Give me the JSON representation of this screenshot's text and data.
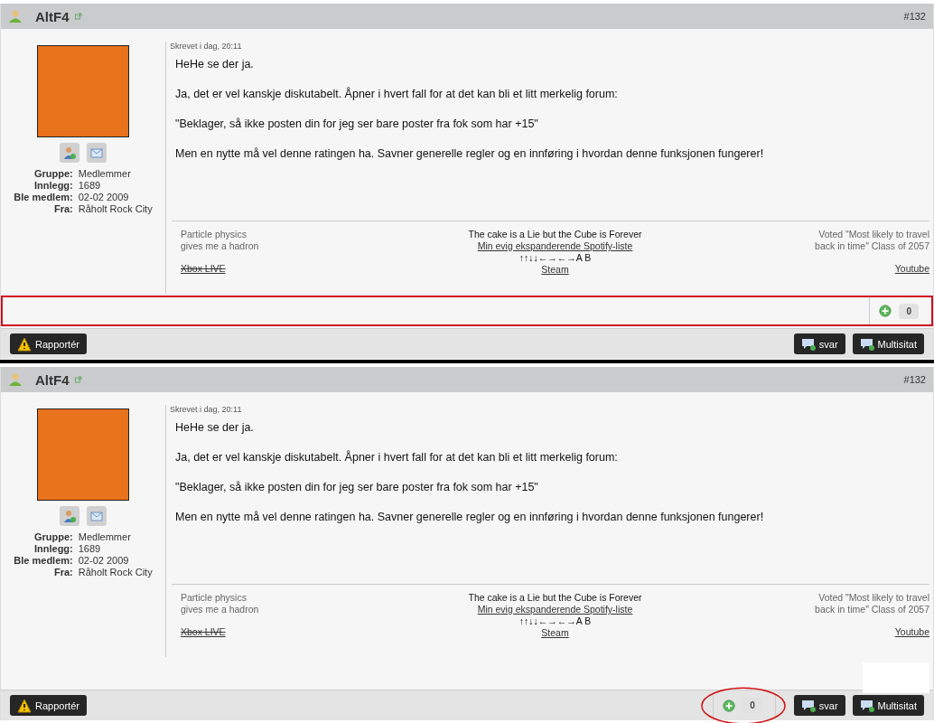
{
  "posts": [
    {
      "author": "AltF4",
      "post_number": "#132",
      "timestamp": "Skrevet i dag, 20:11",
      "info": [
        {
          "label": "Gruppe:",
          "value": "Medlemmer"
        },
        {
          "label": "Innlegg:",
          "value": "1689"
        },
        {
          "label": "Ble medlem:",
          "value": "02-02 2009"
        },
        {
          "label": "Fra:",
          "value": "Råholt Rock City"
        }
      ],
      "paragraphs": [
        "HeHe se der ja.",
        "Ja, det er vel kanskje diskutabelt. Åpner i hvert fall for at det kan bli et litt merkelig forum:",
        "\"Beklager, så ikke posten din for jeg ser bare poster fra fok som har +15\"",
        "Men en nytte må vel denne ratingen ha. Savner generelle regler og en innføring i hvordan denne funksjonen fungerer!"
      ],
      "signature": [
        {
          "kind": "left",
          "items": [
            {
              "kind": "text",
              "text": "Particle physics"
            },
            {
              "kind": "text",
              "text": "gives me a hadron"
            },
            {
              "kind": "gap"
            },
            {
              "kind": "link",
              "text": "Xbox LIVE",
              "struck": true
            }
          ]
        },
        {
          "kind": "center",
          "items": [
            {
              "kind": "strong",
              "text": "The cake is a Lie but the Cube is Forever"
            },
            {
              "kind": "link",
              "text": "Min evig ekspanderende Spotify-liste",
              "struck": false
            },
            {
              "kind": "strong",
              "text": "↑↑↓↓←→←→A B"
            },
            {
              "kind": "link",
              "text": "Steam",
              "struck": false
            }
          ]
        },
        {
          "kind": "right",
          "items": [
            {
              "kind": "text",
              "text": "Voted \"Most likely to travel"
            },
            {
              "kind": "text",
              "text": "back in time\" Class of 2057"
            },
            {
              "kind": "gap"
            },
            {
              "kind": "link",
              "text": "Youtube",
              "struck": false
            }
          ]
        }
      ],
      "rating": {
        "count": "0",
        "kind": "row",
        "annotation": {
          "kind": "box"
        }
      },
      "white_patch": false,
      "buttons": [
        {
          "kind": "report",
          "label": "Rapportér"
        },
        {
          "kind": "reply",
          "label": "svar"
        },
        {
          "kind": "reply",
          "label": "Multisitat"
        }
      ]
    },
    {
      "author": "AltF4",
      "post_number": "#132",
      "timestamp": "Skrevet i dag, 20:11",
      "info": [
        {
          "label": "Gruppe:",
          "value": "Medlemmer"
        },
        {
          "label": "Innlegg:",
          "value": "1689"
        },
        {
          "label": "Ble medlem:",
          "value": "02-02 2009"
        },
        {
          "label": "Fra:",
          "value": "Råholt Rock City"
        }
      ],
      "paragraphs": [
        "HeHe se der ja.",
        "Ja, det er vel kanskje diskutabelt. Åpner i hvert fall for at det kan bli et litt merkelig forum:",
        "\"Beklager, så ikke posten din for jeg ser bare poster fra fok som har +15\"",
        "Men en nytte må vel denne ratingen ha. Savner generelle regler og en innføring i hvordan denne funksjonen fungerer!"
      ],
      "signature": [
        {
          "kind": "left",
          "items": [
            {
              "kind": "text",
              "text": "Particle physics"
            },
            {
              "kind": "text",
              "text": "gives me a hadron"
            },
            {
              "kind": "gap"
            },
            {
              "kind": "link",
              "text": "Xbox LIVE",
              "struck": true
            }
          ]
        },
        {
          "kind": "center",
          "items": [
            {
              "kind": "strong",
              "text": "The cake is a Lie but the Cube is Forever"
            },
            {
              "kind": "link",
              "text": "Min evig ekspanderende Spotify-liste",
              "struck": false
            },
            {
              "kind": "strong",
              "text": "↑↑↓↓←→←→A B"
            },
            {
              "kind": "link",
              "text": "Steam",
              "struck": false
            }
          ]
        },
        {
          "kind": "right",
          "items": [
            {
              "kind": "text",
              "text": "Voted \"Most likely to travel"
            },
            {
              "kind": "text",
              "text": "back in time\" Class of 2057"
            },
            {
              "kind": "gap"
            },
            {
              "kind": "link",
              "text": "Youtube",
              "struck": false
            }
          ]
        }
      ],
      "rating": {
        "count": "0",
        "kind": "toolbar",
        "annotation": {
          "kind": "ellipse"
        }
      },
      "white_patch": true,
      "buttons": [
        {
          "kind": "report",
          "label": "Rapportér"
        },
        {
          "kind": "reply",
          "label": "svar"
        },
        {
          "kind": "reply",
          "label": "Multisitat"
        }
      ]
    }
  ]
}
